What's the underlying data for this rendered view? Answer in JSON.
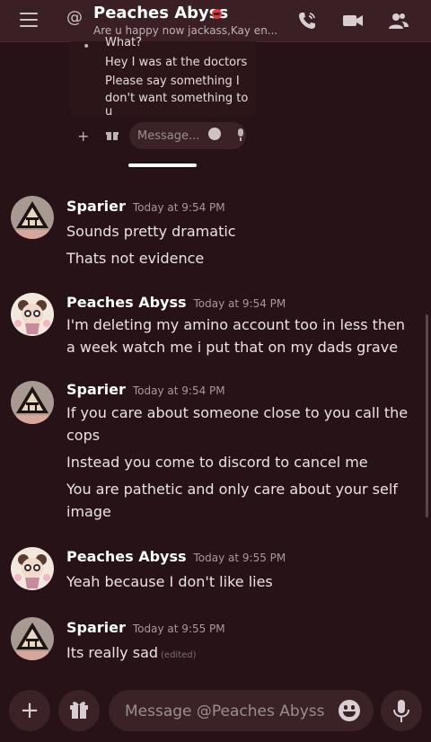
{
  "header": {
    "title": "Peaches Abyss",
    "subtitle": "Are u happy now jackass,Kay en..."
  },
  "preview": {
    "lines": [
      "What?",
      "Hey I was at the doctors",
      "Please say something I",
      "don't want something to u"
    ],
    "placeholder": "Message..."
  },
  "messages": [
    {
      "author": "Sparier",
      "timestamp": "Today at 9:54 PM",
      "lines": [
        "Sounds pretty dramatic",
        "Thats not evidence"
      ]
    },
    {
      "author": "Peaches Abyss",
      "timestamp": "Today at 9:54 PM",
      "lines": [
        "I'm deleting my amino account too in less then a week watch me i put that on my dads grave"
      ]
    },
    {
      "author": "Sparier",
      "timestamp": "Today at 9:54 PM",
      "lines": [
        "If you care about someone close to you call the cops",
        "Instead you come to discord to cancel me",
        "You are pathetic and only care about your self image"
      ]
    },
    {
      "author": "Peaches Abyss",
      "timestamp": "Today at 9:55 PM",
      "lines": [
        "Yeah because I don't like lies"
      ]
    },
    {
      "author": "Sparier",
      "timestamp": "Today at 9:55 PM",
      "lines": [
        "Its really sad"
      ],
      "edited": "(edited)"
    }
  ],
  "composer": {
    "placeholder": "Message @Peaches Abyss"
  },
  "colors": {
    "background": "#261217",
    "header": "#3a1f24",
    "dnd": "#e03a3e"
  }
}
